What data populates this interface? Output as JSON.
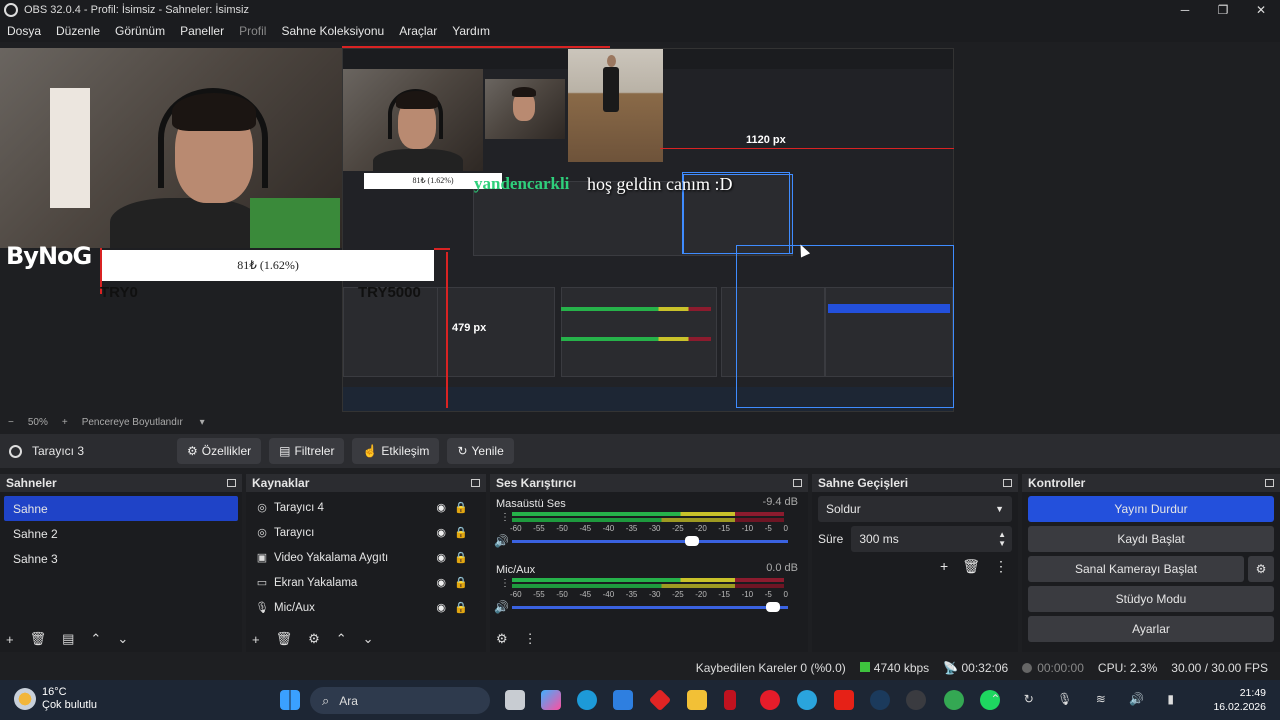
{
  "window": {
    "title": "OBS 32.0.4 - Profil: İsimsiz - Sahneler: İsimsiz"
  },
  "menu": [
    "Dosya",
    "Düzenle",
    "Görünüm",
    "Paneller",
    "Profil",
    "Sahne Koleksiyonu",
    "Araçlar",
    "Yardım"
  ],
  "preview": {
    "logo": "ByNoG",
    "donation": "81₺ (1.62%)",
    "goal_left": "TRY0",
    "goal_right": "TRY5000",
    "px_label_1": "1120 px",
    "px_label_2": "479 px",
    "welcome": "hoş geldin canım :D",
    "ticker": "yandencarkli"
  },
  "zoombar": {
    "minus": "−",
    "zoom": "50%",
    "plus": "+",
    "fit": "Pencereye Boyutlandır"
  },
  "source_toolbar": {
    "selected_source": "Tarayıcı 3",
    "buttons": [
      "Özellikler",
      "Filtreler",
      "Etkileşim",
      "Yenile"
    ]
  },
  "docks": {
    "scenes": {
      "title": "Sahneler",
      "items": [
        "Sahne",
        "Sahne 2",
        "Sahne 3"
      ],
      "selected": 0
    },
    "sources": {
      "title": "Kaynaklar",
      "items": [
        {
          "name": "Tarayıcı 4",
          "icon": "globe-icon"
        },
        {
          "name": "Tarayıcı",
          "icon": "globe-icon"
        },
        {
          "name": "Video Yakalama Aygıtı",
          "icon": "camera-icon"
        },
        {
          "name": "Ekran Yakalama",
          "icon": "monitor-icon"
        },
        {
          "name": "Mic/Aux",
          "icon": "microphone-icon"
        }
      ]
    },
    "mixer": {
      "title": "Ses Karıştırıcı",
      "channels": [
        {
          "name": "Masaüstü Ses",
          "db": "-9.4 dB",
          "volume": 0.66
        },
        {
          "name": "Mic/Aux",
          "db": "0.0 dB",
          "volume": 0.97
        }
      ],
      "scale": [
        "-60",
        "-55",
        "-50",
        "-45",
        "-40",
        "-35",
        "-30",
        "-25",
        "-20",
        "-15",
        "-10",
        "-5",
        "0"
      ]
    },
    "transitions": {
      "title": "Sahne Geçişleri",
      "transition": "Soldur",
      "duration_label": "Süre",
      "duration": "300 ms"
    },
    "controls": {
      "title": "Kontroller",
      "buttons": [
        "Yayını Durdur",
        "Kaydı Başlat",
        "Sanal Kamerayı Başlat",
        "Stüdyo Modu",
        "Ayarlar"
      ]
    }
  },
  "status": {
    "dropped": "Kaybedilen Kareler 0 (%0.0)",
    "bitrate": "4740 kbps",
    "stream_time": "00:32:06",
    "rec_time": "00:00:00",
    "cpu": "CPU: 2.3%",
    "fps": "30.00 / 30.00 FPS"
  },
  "taskbar": {
    "temp": "16°C",
    "weather": "Çok bulutlu",
    "search": "Ara",
    "time": "21:49",
    "date": "16.02.2026"
  }
}
